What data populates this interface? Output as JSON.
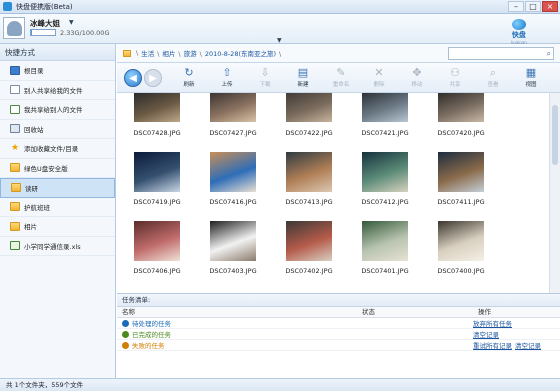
{
  "window": {
    "title": "快盘便携版(Beta)"
  },
  "user": {
    "name": "冰峰大姐",
    "quota_text": "2.33G/100.00G",
    "quota_fraction": 0.023
  },
  "logo": {
    "name": "快盘",
    "sub": "kuaipan"
  },
  "sidebar": {
    "header": "快捷方式",
    "items": [
      {
        "label": "根目录",
        "icon": "root-folder-icon",
        "active": false
      },
      {
        "label": "别人共享给我的文件",
        "icon": "doc-icon",
        "active": false
      },
      {
        "label": "我共享给别人的文件",
        "icon": "share-icon",
        "active": false
      },
      {
        "label": "回收站",
        "icon": "trash-icon",
        "active": false
      },
      {
        "label": "添加收藏文件/目录",
        "icon": "star-icon",
        "active": false
      },
      {
        "label": "绿色U盘安全版",
        "icon": "folder-icon",
        "active": false
      },
      {
        "label": "读研",
        "icon": "folder-icon",
        "active": true
      },
      {
        "label": "护航班班",
        "icon": "folder-icon",
        "active": false
      },
      {
        "label": "相片",
        "icon": "folder-icon",
        "active": false
      },
      {
        "label": "小学同学通信录.xls",
        "icon": "xls-icon",
        "active": false
      }
    ]
  },
  "path": {
    "crumbs": [
      "生活",
      "相片",
      "旅游",
      "2010-8-28(东南亚之旅)"
    ],
    "search_placeholder": ""
  },
  "toolbar": {
    "buttons": [
      {
        "label": "刷新",
        "icon": "↻",
        "disabled": false
      },
      {
        "label": "上传",
        "icon": "⇧",
        "disabled": false
      },
      {
        "label": "下载",
        "icon": "⇩",
        "disabled": true
      },
      {
        "label": "新建",
        "icon": "▤",
        "disabled": false
      },
      {
        "label": "重命名",
        "icon": "✎",
        "disabled": true
      },
      {
        "label": "删除",
        "icon": "✕",
        "disabled": true
      },
      {
        "label": "移动",
        "icon": "✥",
        "disabled": true
      },
      {
        "label": "共享",
        "icon": "⚇",
        "disabled": true
      },
      {
        "label": "查看",
        "icon": "⌕",
        "disabled": true
      },
      {
        "label": "视图",
        "icon": "▦",
        "disabled": false
      }
    ]
  },
  "files": [
    {
      "name": "DSC07428.JPG",
      "colors": [
        "#2a2a2a",
        "#6b5a44",
        "#bfa78a"
      ]
    },
    {
      "name": "DSC07427.JPG",
      "colors": [
        "#3a3330",
        "#8a7260",
        "#d9c2a6"
      ]
    },
    {
      "name": "DSC07422.JPG",
      "colors": [
        "#403a36",
        "#7a6b5c",
        "#c8b49e"
      ]
    },
    {
      "name": "DSC07421.JPG",
      "colors": [
        "#2b2f33",
        "#6c7a86",
        "#b9c7d2"
      ]
    },
    {
      "name": "DSC07420.JPG",
      "colors": [
        "#2e2b28",
        "#7b6e62",
        "#c9b8a6"
      ]
    },
    {
      "name": "DSC07419.JPG",
      "colors": [
        "#0b1a3a",
        "#35506f",
        "#c9d6e6"
      ]
    },
    {
      "name": "DSC07416.JPG",
      "colors": [
        "#c98f58",
        "#2e6db8",
        "#e9e0d2"
      ]
    },
    {
      "name": "DSC07413.JPG",
      "colors": [
        "#2f3b42",
        "#b07f56",
        "#dcc8b2"
      ]
    },
    {
      "name": "DSC07412.JPG",
      "colors": [
        "#16323d",
        "#5c8c78",
        "#d8d2c0"
      ]
    },
    {
      "name": "DSC07411.JPG",
      "colors": [
        "#1d2d40",
        "#8a6a4a",
        "#c4cfd8"
      ]
    },
    {
      "name": "DSC07406.JPG",
      "colors": [
        "#5a2d2a",
        "#c06b6b",
        "#efe2d6"
      ]
    },
    {
      "name": "DSC07403.JPG",
      "colors": [
        "#1e1e1e",
        "#f2f2f2",
        "#8a7b6a"
      ]
    },
    {
      "name": "DSC07402.JPG",
      "colors": [
        "#3b3936",
        "#b55b4a",
        "#d8cfc2"
      ]
    },
    {
      "name": "DSC07401.JPG",
      "colors": [
        "#355a3a",
        "#b8c4b0",
        "#e8e2d4"
      ]
    },
    {
      "name": "DSC07400.JPG",
      "colors": [
        "#3a352e",
        "#d8cfbf",
        "#f5f0e6"
      ]
    }
  ],
  "tasks": {
    "header": "任务清单:",
    "columns": [
      "名称",
      "状态",
      "操作"
    ],
    "rows": [
      {
        "name": "待处理的任务",
        "status": "",
        "actions": [
          "放弃所有任务"
        ],
        "color": "#1a6bb8"
      },
      {
        "name": "已完成的任务",
        "status": "",
        "actions": [
          "清空记录"
        ],
        "color": "#4a8a1f"
      },
      {
        "name": "失败的任务",
        "status": "",
        "actions": [
          "重试所有记录",
          "清空记录"
        ],
        "color": "#d07d00"
      }
    ]
  },
  "status": {
    "text": "共 1个文件夹，559个文件"
  }
}
